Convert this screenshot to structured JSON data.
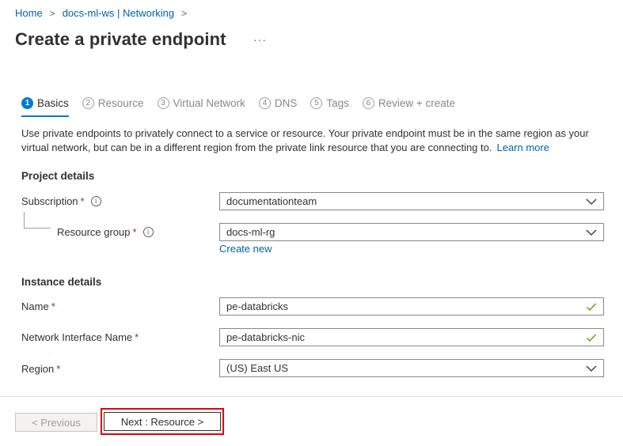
{
  "breadcrumb": {
    "items": [
      "Home",
      "docs-ml-ws | Networking"
    ],
    "separator": ">"
  },
  "page": {
    "title": "Create a private endpoint",
    "more": "···"
  },
  "tabs": [
    {
      "num": "1",
      "label": "Basics",
      "active": true
    },
    {
      "num": "2",
      "label": "Resource",
      "active": false
    },
    {
      "num": "3",
      "label": "Virtual Network",
      "active": false
    },
    {
      "num": "4",
      "label": "DNS",
      "active": false
    },
    {
      "num": "5",
      "label": "Tags",
      "active": false
    },
    {
      "num": "6",
      "label": "Review + create",
      "active": false
    }
  ],
  "description": {
    "text": "Use private endpoints to privately connect to a service or resource. Your private endpoint must be in the same region as your virtual network, but can be in a different region from the private link resource that you are connecting to.",
    "link": "Learn more"
  },
  "project_details": {
    "heading": "Project details",
    "subscription_label": "Subscription",
    "subscription_value": "documentationteam",
    "resource_group_label": "Resource group",
    "resource_group_value": "docs-ml-rg",
    "create_new": "Create new",
    "required_mark": "*",
    "info": "i"
  },
  "instance_details": {
    "heading": "Instance details",
    "name_label": "Name",
    "name_value": "pe-databricks",
    "nic_label": "Network Interface Name",
    "nic_value": "pe-databricks-nic",
    "region_label": "Region",
    "region_value": "(US) East US"
  },
  "footer": {
    "previous": "< Previous",
    "next": "Next : Resource >"
  },
  "colors": {
    "accent": "#0078d4",
    "link": "#0062ad",
    "required": "#a4262c",
    "valid": "#57a300",
    "highlight": "#e3000f"
  }
}
